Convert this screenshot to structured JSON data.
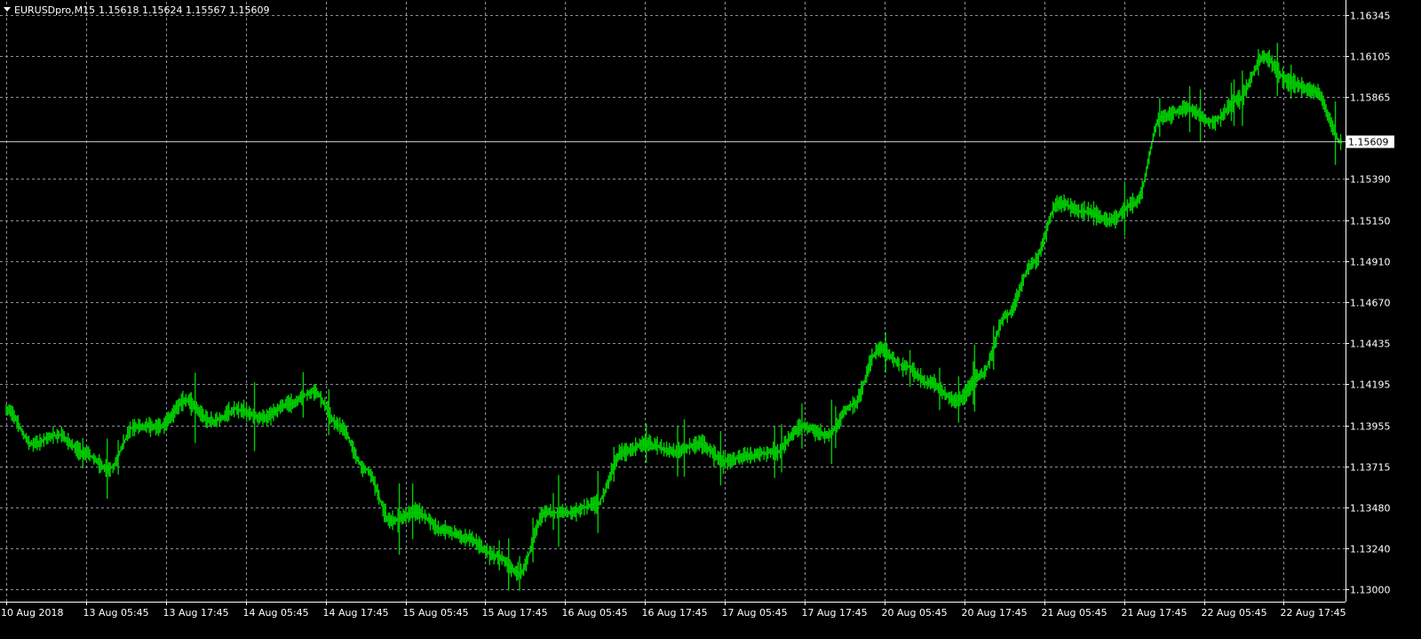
{
  "header": {
    "symbol": "EURUSDpro,M15",
    "ohlc": "1.15618 1.15624 1.15567 1.15609",
    "collapse_icon": "triangle-down-icon"
  },
  "colors": {
    "background": "#000000",
    "grid": "#8a8f9f",
    "price_line": "#00cc00",
    "text": "#ffffff",
    "axis": "#ffffff"
  },
  "chart_data": {
    "type": "line",
    "title": "",
    "xlabel": "",
    "ylabel": "",
    "grid": true,
    "ylim": [
      1.1293,
      1.1642
    ],
    "y_ticks": [
      "1.16345",
      "1.16105",
      "1.15865",
      "1.15390",
      "1.15150",
      "1.14910",
      "1.14670",
      "1.14435",
      "1.14195",
      "1.13955",
      "1.13715",
      "1.13480",
      "1.13240",
      "1.13000"
    ],
    "y_tick_values": [
      1.16345,
      1.16105,
      1.15865,
      1.1539,
      1.1515,
      1.1491,
      1.1467,
      1.14435,
      1.14195,
      1.13955,
      1.13715,
      1.1348,
      1.1324,
      1.13
    ],
    "x_ticks": [
      "10 Aug 2018",
      "13 Aug 05:45",
      "13 Aug 17:45",
      "14 Aug 05:45",
      "14 Aug 17:45",
      "15 Aug 05:45",
      "15 Aug 17:45",
      "16 Aug 05:45",
      "16 Aug 17:45",
      "17 Aug 05:45",
      "17 Aug 17:45",
      "20 Aug 05:45",
      "20 Aug 17:45",
      "21 Aug 05:45",
      "21 Aug 17:45",
      "22 Aug 05:45",
      "22 Aug 17:45"
    ],
    "current_price": "1.15609",
    "current_price_value": 1.15609,
    "series": [
      {
        "x": [
          "10 Aug 2018",
          "10 Aug 2018",
          "10 Aug 2018",
          "13 Aug 05:45",
          "13 Aug 05:45",
          "13 Aug 05:45",
          "13 Aug 05:45",
          "13 Aug 17:45",
          "13 Aug 17:45",
          "13 Aug 17:45",
          "13 Aug 17:45",
          "14 Aug 05:45",
          "14 Aug 05:45",
          "14 Aug 05:45",
          "14 Aug 05:45",
          "14 Aug 17:45",
          "14 Aug 17:45",
          "14 Aug 17:45",
          "15 Aug 05:45",
          "15 Aug 05:45",
          "15 Aug 05:45",
          "15 Aug 17:45",
          "15 Aug 17:45",
          "15 Aug 17:45",
          "16 Aug 05:45",
          "16 Aug 05:45",
          "16 Aug 05:45",
          "16 Aug 17:45",
          "16 Aug 17:45",
          "16 Aug 17:45",
          "17 Aug 05:45",
          "17 Aug 05:45",
          "17 Aug 05:45",
          "17 Aug 17:45",
          "17 Aug 17:45",
          "17 Aug 17:45",
          "20 Aug 05:45",
          "20 Aug 05:45",
          "20 Aug 05:45",
          "20 Aug 17:45",
          "20 Aug 17:45",
          "20 Aug 17:45",
          "21 Aug 05:45",
          "21 Aug 05:45",
          "21 Aug 05:45",
          "21 Aug 17:45",
          "21 Aug 17:45",
          "21 Aug 17:45",
          "22 Aug 05:45",
          "22 Aug 05:45",
          "22 Aug 05:45",
          "22 Aug 17:45",
          "22 Aug 17:45"
        ],
        "y": [
          1.1405,
          1.1385,
          1.139,
          1.138,
          1.137,
          1.1395,
          1.1395,
          1.141,
          1.1398,
          1.1405,
          1.14,
          1.1408,
          1.1415,
          1.1395,
          1.137,
          1.134,
          1.1345,
          1.1335,
          1.133,
          1.132,
          1.131,
          1.1345,
          1.1345,
          1.135,
          1.138,
          1.1385,
          1.138,
          1.1385,
          1.1375,
          1.1378,
          1.138,
          1.1395,
          1.139,
          1.1408,
          1.144,
          1.143,
          1.142,
          1.141,
          1.1425,
          1.146,
          1.149,
          1.1525,
          1.152,
          1.1515,
          1.1525,
          1.1575,
          1.158,
          1.1572,
          1.1585,
          1.161,
          1.1595,
          1.159,
          1.1561
        ]
      }
    ]
  }
}
